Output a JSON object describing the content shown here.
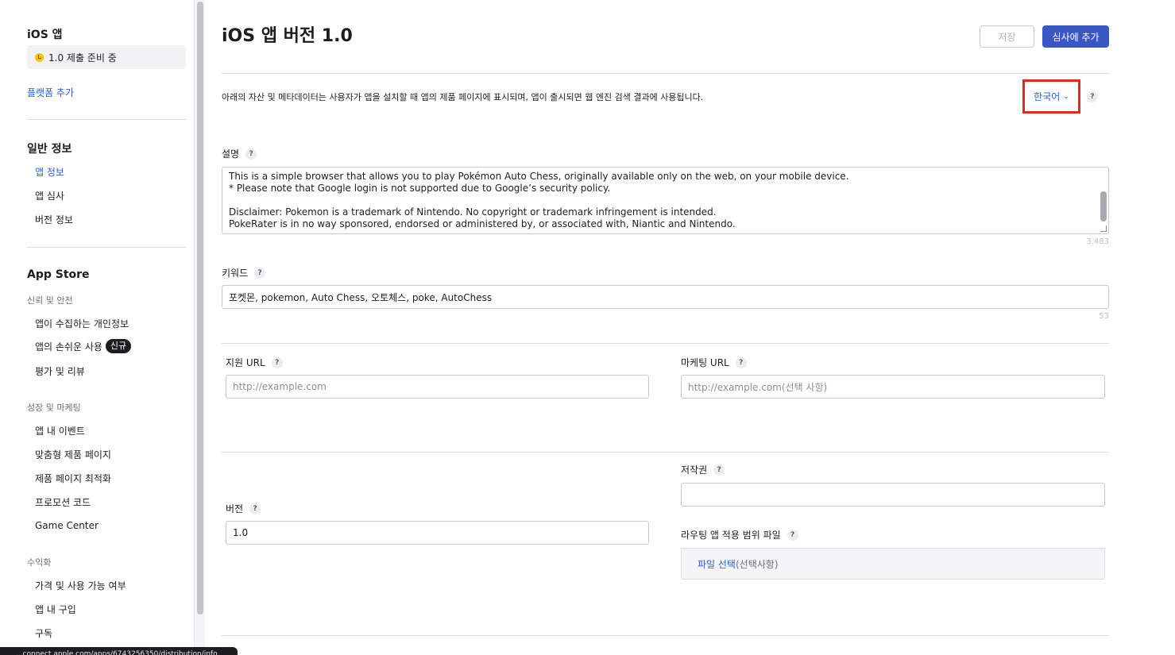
{
  "sidebar": {
    "platform_title": "iOS 앱",
    "status": "1.0 제출 준비 중",
    "add_platform": "플랫폼 추가",
    "general_title": "일반 정보",
    "general_items": [
      "앱 정보",
      "앱 심사",
      "버전 정보"
    ],
    "appstore_title": "App Store",
    "trust_title": "신뢰 및 안전",
    "trust_items": [
      "앱이 수집하는 개인정보",
      "앱의 손쉬운 사용",
      "평가 및 리뷰"
    ],
    "new_badge": "신규",
    "growth_title": "성장 및 마케팅",
    "growth_items": [
      "앱 내 이벤트",
      "맞춤형 제품 페이지",
      "제품 페이지 최적화",
      "프로모션 코드",
      "Game Center"
    ],
    "monetize_title": "수익화",
    "monetize_items": [
      "가격 및 사용 가능 여부",
      "앱 내 구입",
      "구독"
    ]
  },
  "status_bar_url": "...connect.apple.com/apps/6743256350/distribution/info",
  "header": {
    "title": "iOS 앱 버전 1.0",
    "save_label": "저장",
    "submit_label": "심사에 추가"
  },
  "intro": "아래의 자산 및 메타데이터는 사용자가 앱을 설치할 때 앱의 제품 페이지에 표시되며, 앱이 출시되면 웹 엔진 검색 결과에 사용됩니다.",
  "language": {
    "selected": "한국어",
    "help": "?"
  },
  "description": {
    "label": "설명",
    "lines": [
      "This is a simple browser that allows you to play Pokémon Auto Chess, originally available only on the web, on your mobile device.",
      "* Please note that Google login is not supported due to Google’s security policy.",
      "",
      "Disclaimer: Pokemon is a trademark of Nintendo. No copyright or trademark infringement is intended.",
      "PokeRater is in no way sponsored, endorsed or administered by, or associated with, Niantic and Nintendo."
    ],
    "counter": "3,483"
  },
  "keywords": {
    "label": "키워드",
    "value": "포켓몬, pokemon, Auto Chess, 오토체스, poke, AutoChess",
    "counter": "53"
  },
  "support_url": {
    "label": "지원 URL",
    "placeholder": "http://example.com"
  },
  "marketing_url": {
    "label": "마케팅 URL",
    "placeholder": "http://example.com(선택 사항)"
  },
  "version": {
    "label": "버전",
    "value": "1.0"
  },
  "copyright": {
    "label": "저작권",
    "value": ""
  },
  "routing_file": {
    "label": "라우팅 앱 적용 범위 파일",
    "link": "파일 선택",
    "suffix": "(선택사항)"
  },
  "colors": {
    "accent": "#3a57c4",
    "link": "#2d5bd6",
    "highlight": "#e02a1e",
    "status_dot": "#f5c400"
  }
}
